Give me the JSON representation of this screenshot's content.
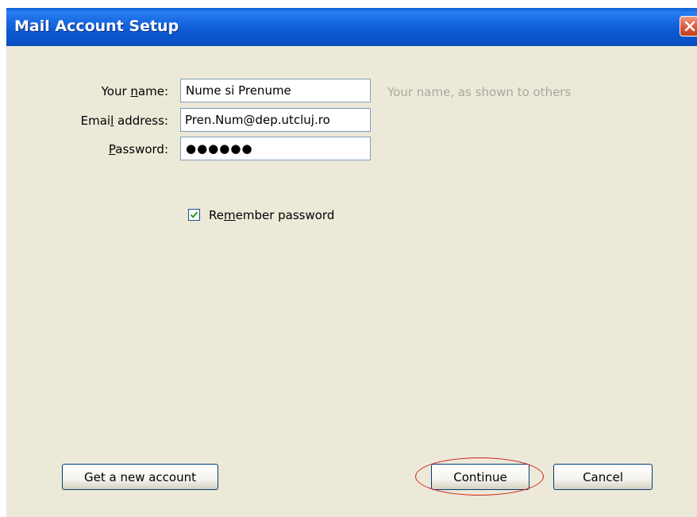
{
  "window": {
    "title": "Mail Account Setup"
  },
  "form": {
    "name_label": "Your name:",
    "name_label_accesskey": "n",
    "name_value": "Nume si Prenume",
    "name_hint": "Your name, as shown to others",
    "email_label": "Email address:",
    "email_label_accesskey": "l",
    "email_value": "Pren.Num@dep.utcluj.ro",
    "password_label": "Password:",
    "password_label_accesskey": "P",
    "password_value": "●●●●●●",
    "remember_label": "Remember password",
    "remember_checked": true
  },
  "buttons": {
    "new_account": "Get a new account",
    "continue": "Continue",
    "cancel": "Cancel"
  },
  "annotation": {
    "highlight_color": "#d02020"
  },
  "icons": {
    "close": "close-icon",
    "check": "checkmark-icon"
  }
}
